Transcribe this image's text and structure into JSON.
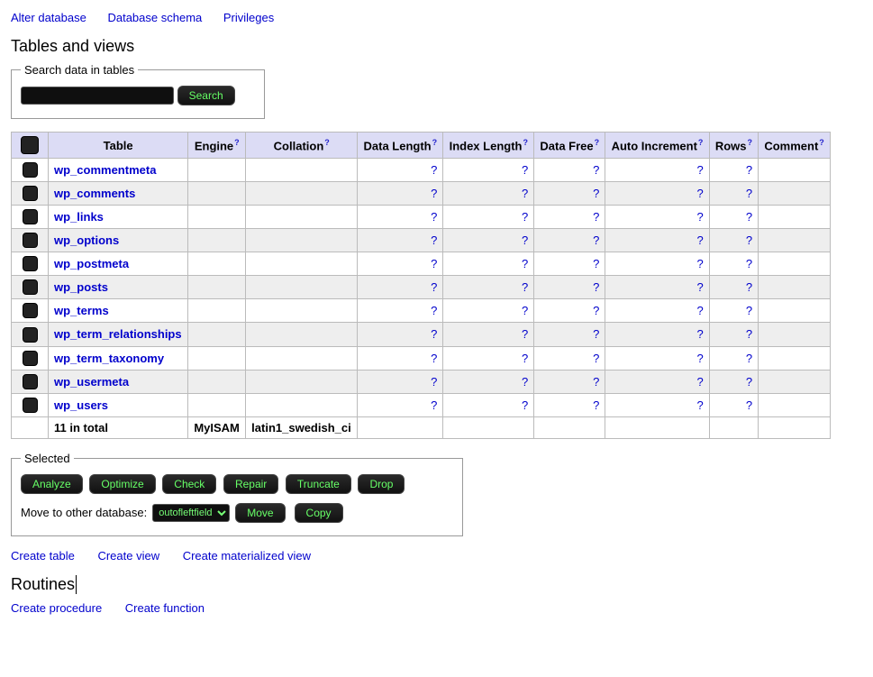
{
  "top_links": {
    "alter": "Alter database",
    "schema": "Database schema",
    "privileges": "Privileges"
  },
  "heading": "Tables and views",
  "search": {
    "legend": "Search data in tables",
    "value": "",
    "button": "Search"
  },
  "columns": {
    "table": "Table",
    "engine": "Engine",
    "collation": "Collation",
    "data_length": "Data Length",
    "index_length": "Index Length",
    "data_free": "Data Free",
    "auto_inc": "Auto Increment",
    "rows": "Rows",
    "comment": "Comment"
  },
  "qmark": "?",
  "tables": [
    {
      "name": "wp_commentmeta"
    },
    {
      "name": "wp_comments"
    },
    {
      "name": "wp_links"
    },
    {
      "name": "wp_options"
    },
    {
      "name": "wp_postmeta"
    },
    {
      "name": "wp_posts"
    },
    {
      "name": "wp_terms"
    },
    {
      "name": "wp_term_relationships"
    },
    {
      "name": "wp_term_taxonomy"
    },
    {
      "name": "wp_usermeta"
    },
    {
      "name": "wp_users"
    }
  ],
  "footer": {
    "total_label": "11 in total",
    "engine": "MyISAM",
    "collation": "latin1_swedish_ci"
  },
  "selected": {
    "legend": "Selected",
    "buttons": {
      "analyze": "Analyze",
      "optimize": "Optimize",
      "check": "Check",
      "repair": "Repair",
      "truncate": "Truncate",
      "drop": "Drop",
      "move": "Move",
      "copy": "Copy"
    },
    "move_label": "Move to other database:",
    "db_selected": "outofleftfield"
  },
  "bottom_links": {
    "create_table": "Create table",
    "create_view": "Create view",
    "create_mat_view": "Create materialized view"
  },
  "routines_heading": "Routines",
  "routine_links": {
    "create_procedure": "Create procedure",
    "create_function": "Create function"
  }
}
